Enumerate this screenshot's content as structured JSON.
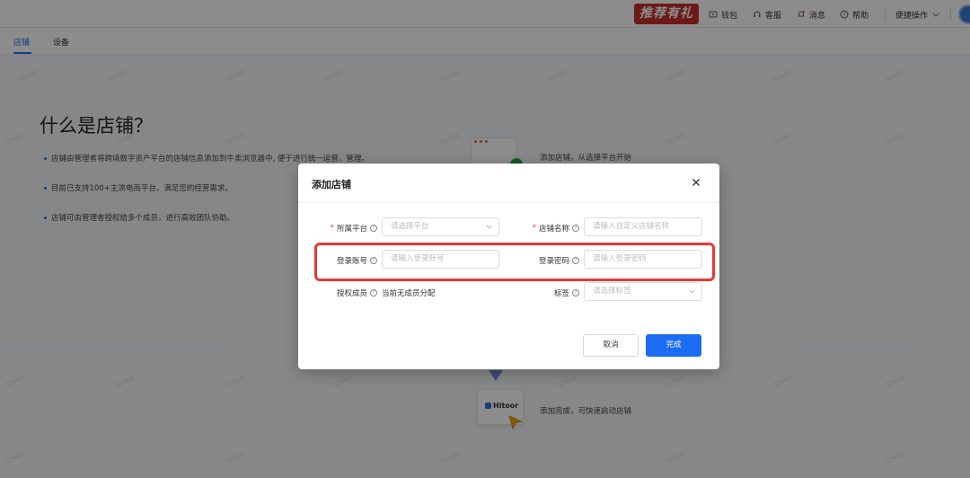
{
  "header": {
    "promo_label": "推荐有礼",
    "nav": [
      {
        "label": "钱包",
        "icon": "wallet-icon"
      },
      {
        "label": "客服",
        "icon": "headset-icon"
      },
      {
        "label": "消息",
        "icon": "bell-icon"
      },
      {
        "label": "帮助",
        "icon": "help-icon"
      }
    ],
    "quick_ops_label": "便捷操作"
  },
  "tabs": [
    {
      "label": "店铺",
      "active": true
    },
    {
      "label": "设备",
      "active": false
    }
  ],
  "page": {
    "heading": "什么是店铺？",
    "bullets": [
      "店铺由管理者将跨境数字资产平台的店铺信息添加到牛卖浏览器中, 便于进行统一运营、管理。",
      "目前已支持100+主流电商平台，满足您的经营需求。",
      "店铺可由管理者授权给多个成员，进行高效团队协助。"
    ],
    "steps": [
      "添加店铺，从选择平台开始",
      "添加完成，可快速启动店铺"
    ],
    "hitoor_label": "Hitoor",
    "watermark_text": "32460"
  },
  "modal": {
    "title": "添加店铺",
    "fields": {
      "platform": {
        "label": "所属平台",
        "placeholder": "请选择平台",
        "required": true
      },
      "shop_name": {
        "label": "店铺名称",
        "placeholder": "请输入自定义店铺名称",
        "required": true
      },
      "account": {
        "label": "登录账号",
        "placeholder": "请输入登录账号"
      },
      "password": {
        "label": "登录密码",
        "placeholder": "请输入登录密码"
      },
      "members": {
        "label": "授权成员",
        "value": "当前无成员分配"
      },
      "tags": {
        "label": "标签",
        "placeholder": "请选择标签"
      }
    },
    "required_mark": "*",
    "help_mark": "?",
    "cancel_label": "取消",
    "confirm_label": "完成"
  },
  "colors": {
    "accent": "#1a6cf2",
    "highlight": "#e53935",
    "promo": "#c6302b"
  }
}
